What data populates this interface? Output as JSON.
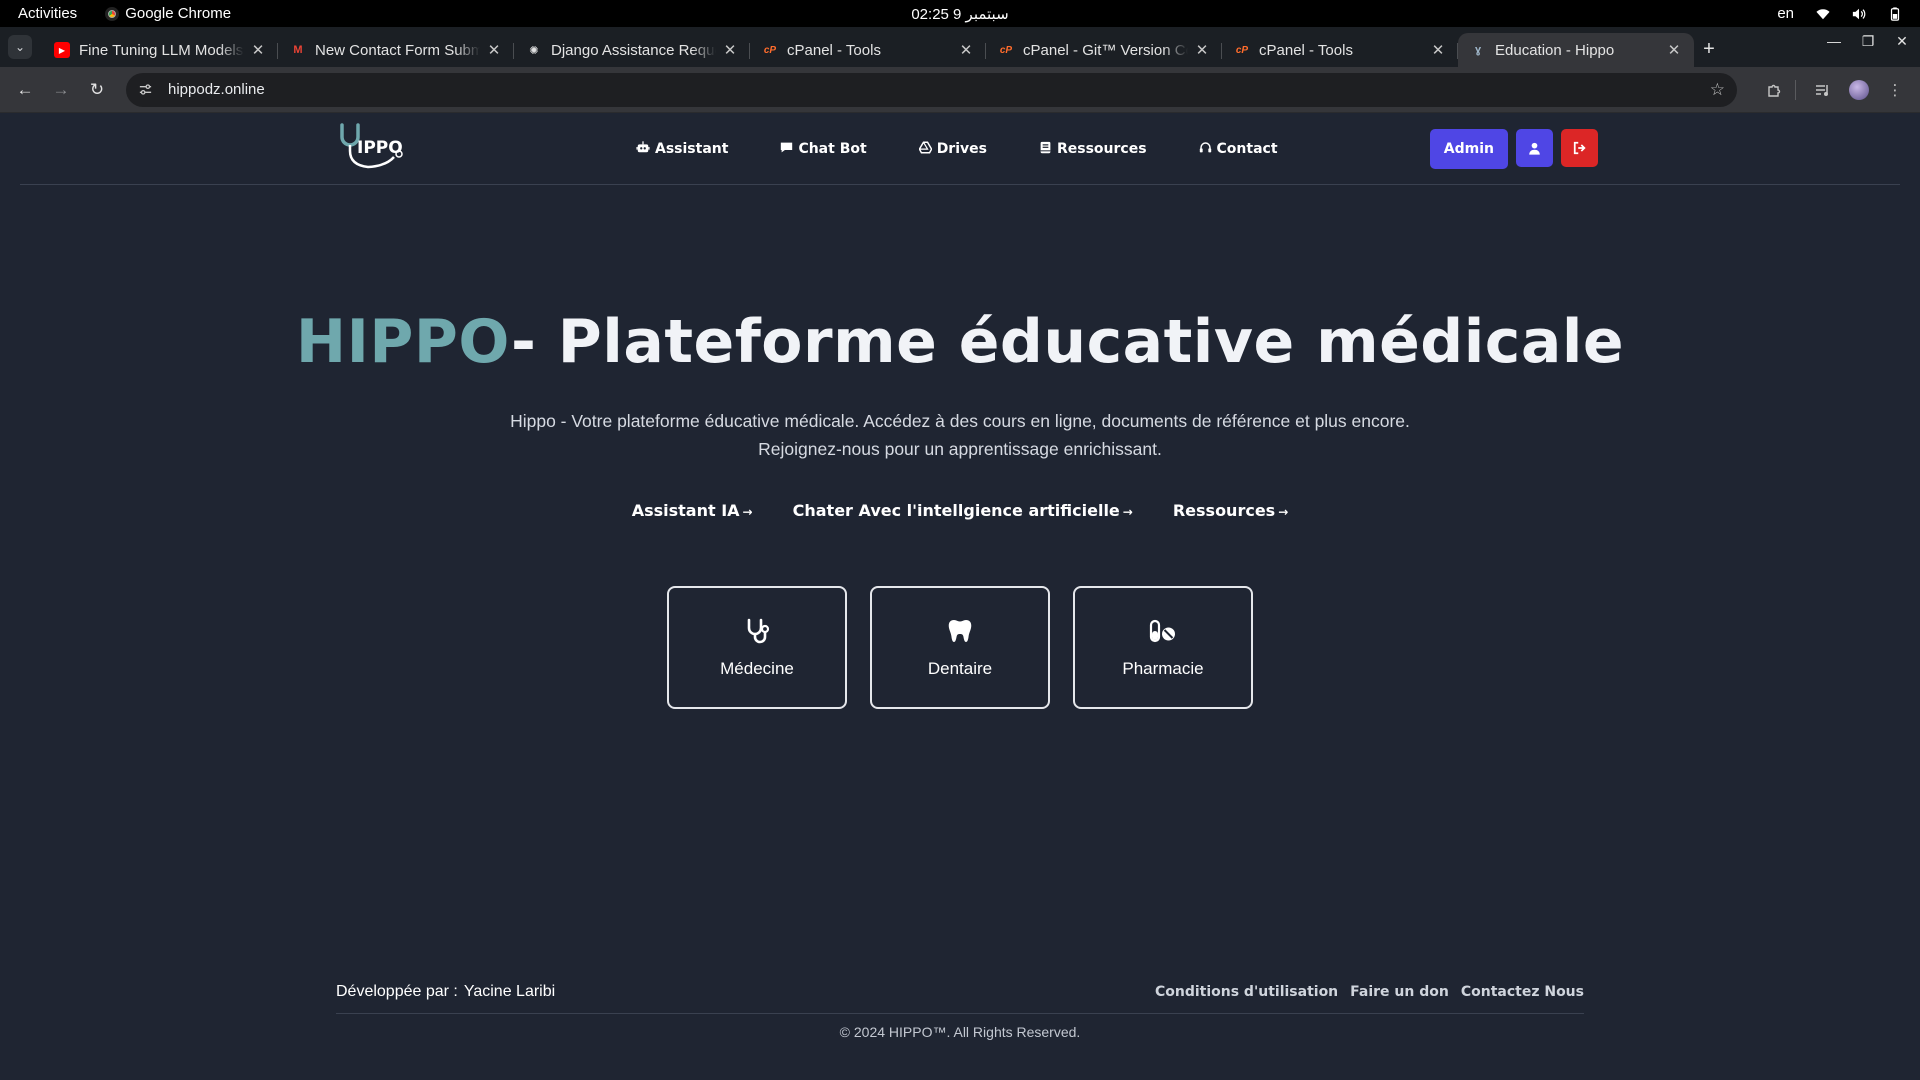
{
  "system_bar": {
    "activities": "Activities",
    "app_name": "Google Chrome",
    "clock": "02:25  9 سبتمبر",
    "language": "en"
  },
  "tabs": [
    {
      "title": "Fine Tuning LLM Models",
      "favicon": "youtube-icon",
      "color": "#ff0000"
    },
    {
      "title": "New Contact Form Submission",
      "favicon": "gmail-icon",
      "color": "#ea4335"
    },
    {
      "title": "Django Assistance Request",
      "favicon": "openai-icon",
      "color": "#e3e3e3"
    },
    {
      "title": "cPanel - Tools",
      "favicon": "cpanel-icon",
      "color": "#ff6c2c"
    },
    {
      "title": "cPanel - Git™ Version Control",
      "favicon": "cpanel-icon",
      "color": "#ff6c2c"
    },
    {
      "title": "cPanel - Tools",
      "favicon": "cpanel-icon",
      "color": "#ff6c2c"
    },
    {
      "title": "Education - Hippo",
      "favicon": "hippo-icon",
      "color": "#9fb6c9",
      "active": true
    }
  ],
  "address_bar": {
    "url": "hippodz.online"
  },
  "site": {
    "nav": [
      {
        "label": "Assistant",
        "icon": "robot-icon"
      },
      {
        "label": "Chat Bot",
        "icon": "chat-icon"
      },
      {
        "label": "Drives",
        "icon": "google-drive-icon"
      },
      {
        "label": "Ressources",
        "icon": "book-icon"
      },
      {
        "label": "Contact",
        "icon": "headset-icon"
      }
    ],
    "admin_label": "Admin",
    "colors": {
      "background": "#1f2532",
      "brand": "#6fa8ad",
      "primary": "#4f46e5",
      "danger": "#dc2626"
    }
  },
  "hero": {
    "brand": "HIPPO",
    "title_rest": "- Plateforme éducative médicale",
    "desc_line1": "Hippo - Votre plateforme éducative médicale. Accédez à des cours en ligne, documents de référence et plus encore.",
    "desc_line2": "Rejoignez-nous pour un apprentissage enrichissant.",
    "links": [
      {
        "label": "Assistant IA",
        "arrow": "→"
      },
      {
        "label": "Chater Avec l'intellgience artificielle",
        "arrow": "→"
      },
      {
        "label": "Ressources",
        "arrow": "→"
      }
    ]
  },
  "cards": [
    {
      "label": "Médecine",
      "icon": "stethoscope-icon"
    },
    {
      "label": "Dentaire",
      "icon": "tooth-icon"
    },
    {
      "label": "Pharmacie",
      "icon": "pills-icon"
    }
  ],
  "footer": {
    "dev_prefix": "Développée par :",
    "dev_name": "Yacine Laribi",
    "links": [
      "Conditions d'utilisation",
      "Faire un don",
      "Contactez Nous"
    ],
    "copyright": "© 2024 HIPPO™. All Rights Reserved."
  }
}
